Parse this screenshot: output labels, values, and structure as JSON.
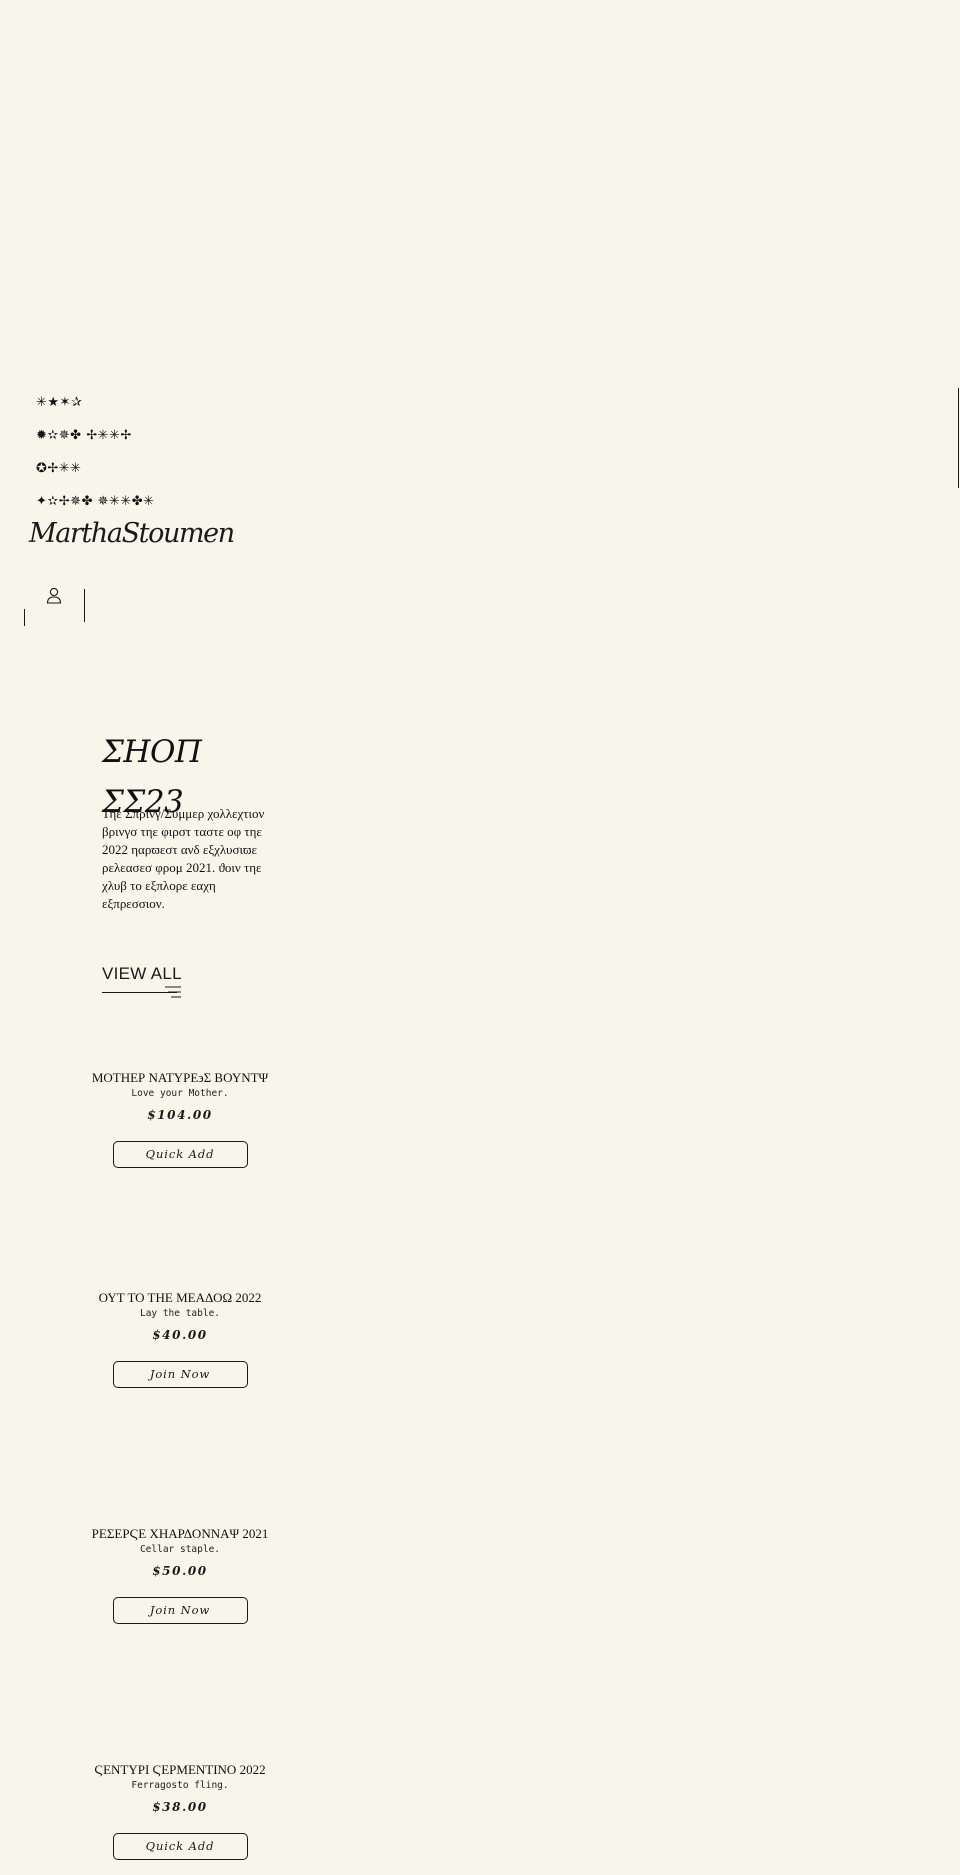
{
  "nav": {
    "items": [
      "✳★✶✰",
      "✹✫✵✤ ✢✳✳✢",
      "✪✢✳✳",
      "✦✫✢✵✤ ✵✳✳✤✳"
    ]
  },
  "brand": {
    "logo": "MarthaStoumen"
  },
  "shop": {
    "title_line1": "ΣΗΟΠ",
    "title_line2": "ΣΣ23",
    "description": "Τηε Σπρινγ/Συμμερ χολλεχτιον βρινγσ τηε φιρστ ταστε οφ τηε 2022 ηαρϖεστ ανδ εξχλυσιϖε ρελεασεσ φρομ 2021. ϑοιν τηε χλυβ το εξπλορε εαχη εξπρεσσιον.",
    "view_all": "VIEW ALL"
  },
  "products": [
    {
      "name": "ΜΟΤΗΕΡ ΝΑΤΥΡΕ϶Σ ΒΟΥΝΤΨ",
      "tagline": "Love your Mother.",
      "price": "$104.00",
      "action": "Quick Add"
    },
    {
      "name": "ΟΥΤ ΤΟ ΤΗΕ ΜΕΑΔΟΩ 2022",
      "tagline": "Lay the table.",
      "price": "$40.00",
      "action": "Join Now"
    },
    {
      "name": "ΡΕΣΕΡϚΕ ΧΗΑΡΔΟΝΝΑΨ 2021",
      "tagline": "Cellar staple.",
      "price": "$50.00",
      "action": "Join Now"
    },
    {
      "name": "ϚΕΝΤΥΡΙ ϚΕΡΜΕΝΤΙΝΟ 2022",
      "tagline": "Ferragosto fling.",
      "price": "$38.00",
      "action": "Quick Add"
    }
  ],
  "icons": {
    "account": "user-icon",
    "filter": "filter-lines-icon"
  },
  "colors": {
    "background": "#f8f5eb",
    "ink": "#1a1a1a"
  }
}
